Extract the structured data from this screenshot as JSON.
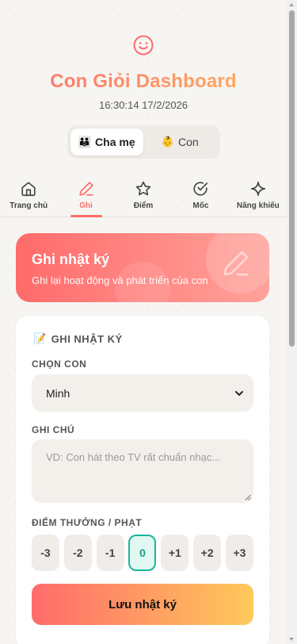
{
  "header": {
    "title": "Con Giỏi Dashboard",
    "datetime": "16:30:14 17/2/2026"
  },
  "role_toggle": {
    "options": [
      {
        "emoji": "👪",
        "label": "Cha mẹ",
        "selected": true
      },
      {
        "emoji": "👶",
        "label": "Con",
        "selected": false
      }
    ]
  },
  "nav": {
    "items": [
      {
        "label": "Trang chủ",
        "icon": "home-icon",
        "active": false
      },
      {
        "label": "Ghi",
        "icon": "pencil-icon",
        "active": true
      },
      {
        "label": "Điểm",
        "icon": "star-icon",
        "active": false
      },
      {
        "label": "Mốc",
        "icon": "check-circle-icon",
        "active": false
      },
      {
        "label": "Năng khiếu",
        "icon": "sparkle-icon",
        "active": false
      }
    ]
  },
  "banner": {
    "title": "Ghi nhật ký",
    "subtitle": "Ghi lại hoạt động và phát triển của con"
  },
  "form": {
    "title_emoji": "📝",
    "title": "GHI NHẬT KÝ",
    "child_label": "CHỌN CON",
    "child_value": "Minh",
    "note_label": "GHI CHÚ",
    "note_placeholder": "VD: Con hát theo TV rất chuẩn nhạc...",
    "score_label": "ĐIỂM THƯỞNG / PHẠT",
    "scores": [
      "-3",
      "-2",
      "-1",
      "0",
      "+1",
      "+2",
      "+3"
    ],
    "selected_score": "0",
    "save_label": "Lưu nhật ký"
  },
  "colors": {
    "accent": "#ff6b6b",
    "gradient_end": "#ffc95a",
    "selected_score": "#1bb59b"
  }
}
